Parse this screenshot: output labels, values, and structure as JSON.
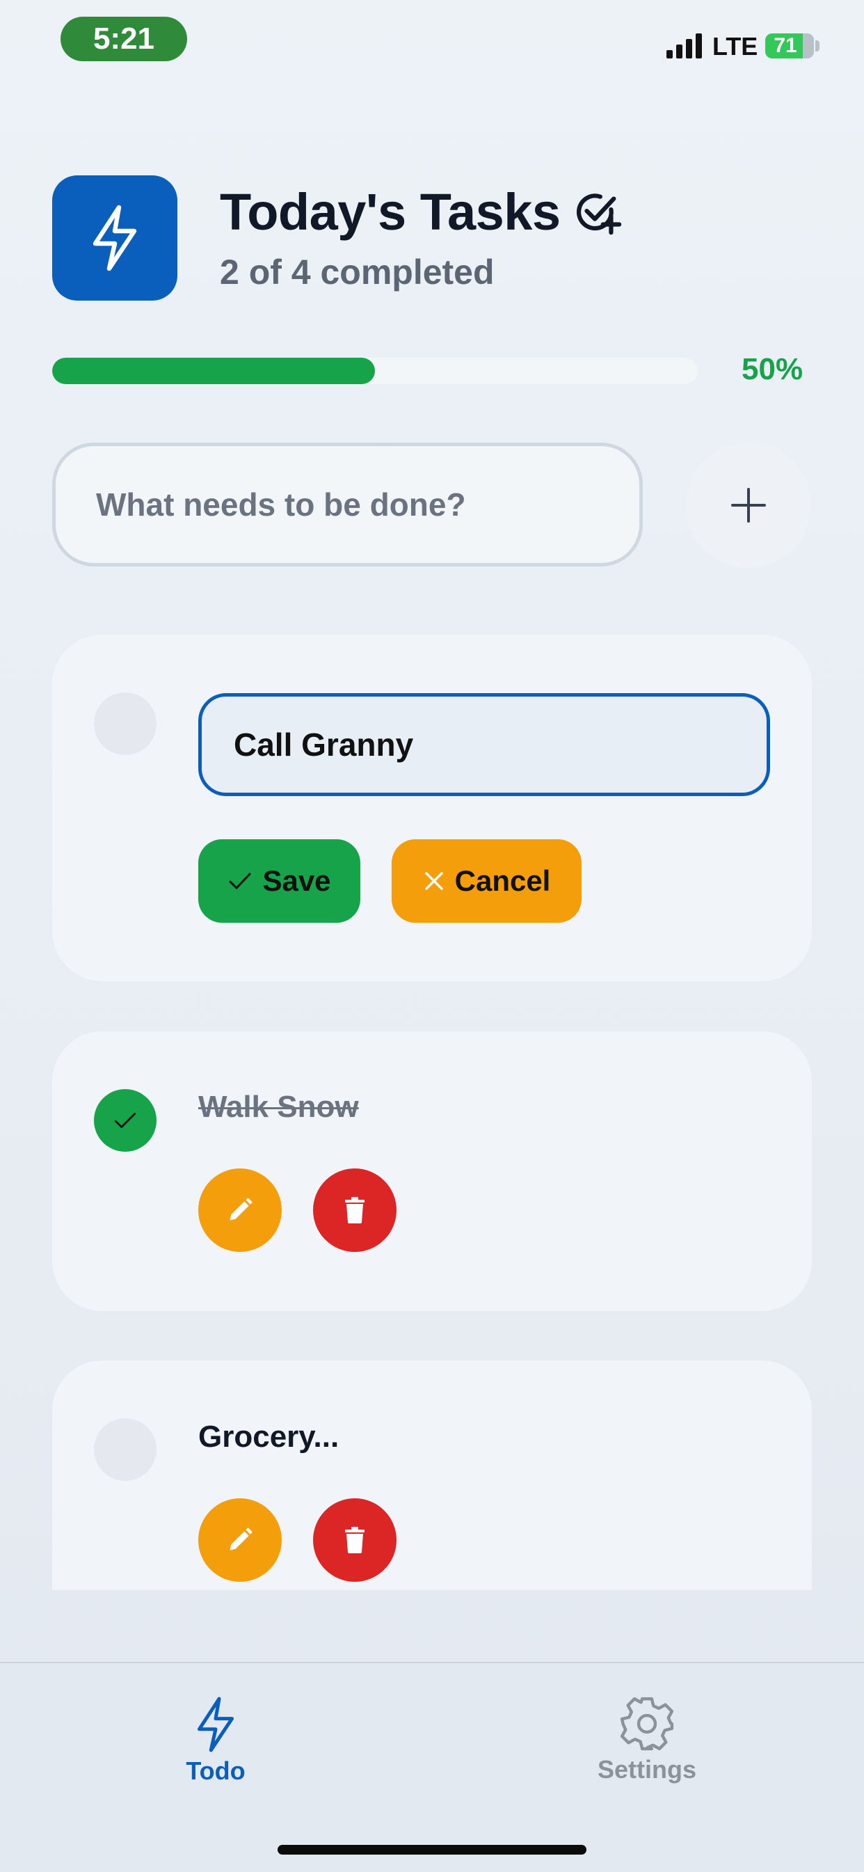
{
  "status_bar": {
    "time": "5:21",
    "network": "LTE",
    "battery": "71"
  },
  "header": {
    "title": "Today's Tasks",
    "subtitle": "2 of 4 completed",
    "app_icon": "bolt-icon",
    "title_icon": "check-circle-plus-icon"
  },
  "progress": {
    "percent_label": "50%",
    "value": 0.5
  },
  "new_task": {
    "placeholder": "What needs to be done?",
    "add_icon": "plus-icon"
  },
  "editing_task": {
    "value": "Call Granny",
    "save_label": "Save",
    "cancel_label": "Cancel"
  },
  "tasks": [
    {
      "text": "Walk Snow",
      "completed": true
    },
    {
      "text": "Grocery...",
      "completed": false
    }
  ],
  "tabbar": {
    "items": [
      {
        "label": "Todo",
        "icon": "bolt-icon",
        "active": true
      },
      {
        "label": "Settings",
        "icon": "gear-icon",
        "active": false
      }
    ]
  },
  "colors": {
    "primary": "#0a5fbd",
    "success": "#17a34a",
    "warning": "#f59e0b",
    "danger": "#dc2626"
  }
}
